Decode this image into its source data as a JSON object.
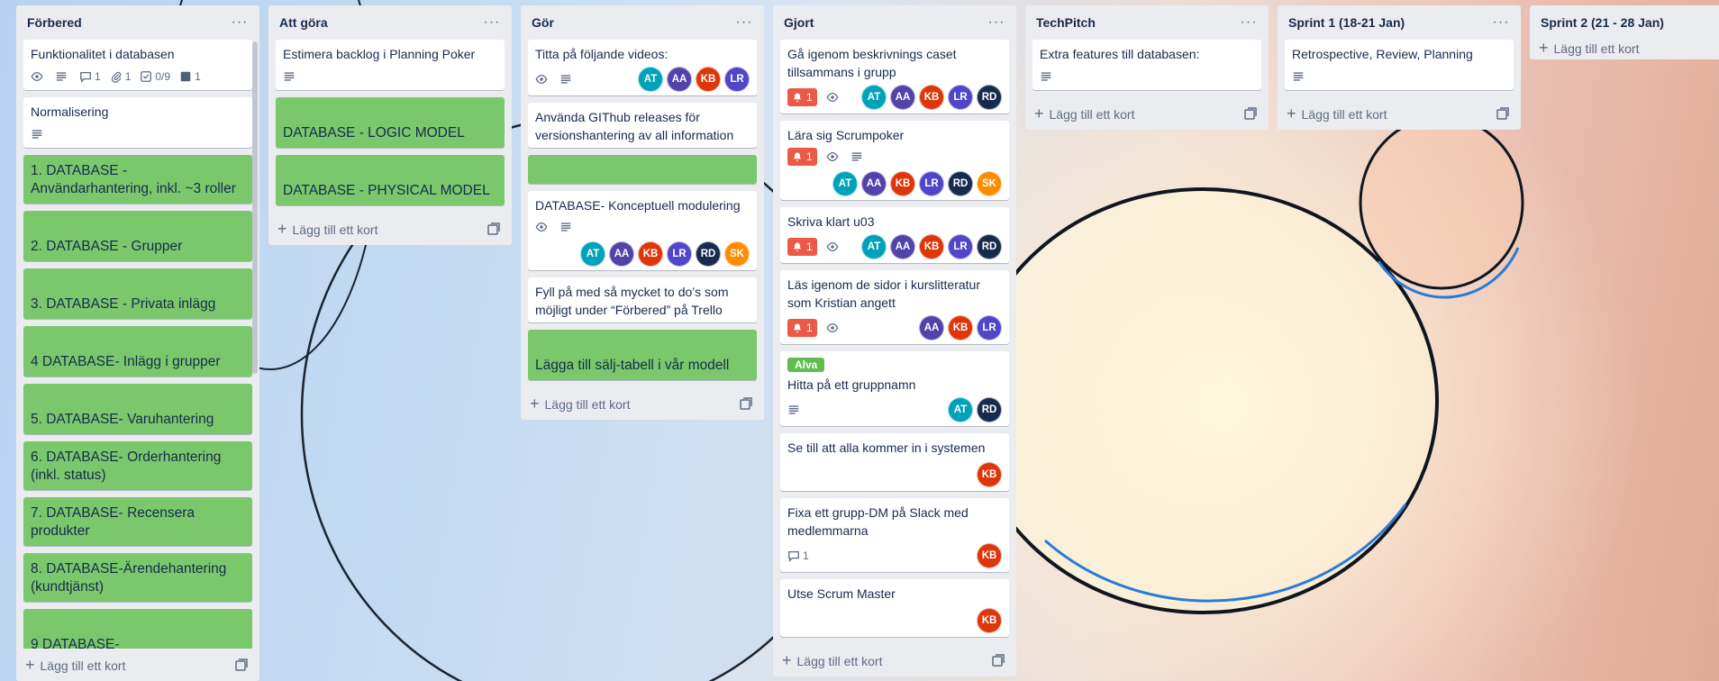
{
  "add_card_label": "Lägg till ett kort",
  "colors": {
    "green_card": "#7bc86c",
    "notification": "#eb5a46",
    "label_green": "#61bd4f"
  },
  "members": {
    "AT": {
      "initials": "AT",
      "color": "#00a2b9"
    },
    "AA": {
      "initials": "AA",
      "color": "#5243aa"
    },
    "KB": {
      "initials": "KB",
      "color": "#de350b"
    },
    "LR": {
      "initials": "LR",
      "color": "#4f46c8"
    },
    "RD": {
      "initials": "RD",
      "color": "#172b4d"
    },
    "SK": {
      "initials": "SK",
      "color": "#ff8b00"
    }
  },
  "lists": [
    {
      "title": "Förbered",
      "cards": [
        {
          "title": "Funktionalitet i databasen",
          "badges": {
            "watch": true,
            "desc": true,
            "comments": "1",
            "attachments": "1",
            "checklist": "0/9",
            "cover": "1"
          }
        },
        {
          "title": "Normalisering",
          "badges": {
            "desc": true
          }
        },
        {
          "title": "1. DATABASE - Användarhantering, inkl. ~3 roller",
          "green": true
        },
        {
          "title": "2. DATABASE - Grupper",
          "green": true
        },
        {
          "title": "3. DATABASE - Privata inlägg",
          "green": true
        },
        {
          "title": "4 DATABASE- Inlägg i grupper",
          "green": true
        },
        {
          "title": "5. DATABASE- Varuhantering",
          "green": true
        },
        {
          "title": "6. DATABASE- Orderhantering (inkl. status)",
          "green": true
        },
        {
          "title": "7. DATABASE- Recensera produkter",
          "green": true
        },
        {
          "title": "8. DATABASE-Ärendehantering (kundtjänst)",
          "green": true
        },
        {
          "title": "9 DATABASE-",
          "green": true
        }
      ]
    },
    {
      "title": "Att göra",
      "cards": [
        {
          "title": "Estimera backlog i Planning Poker",
          "badges": {
            "desc": true
          }
        },
        {
          "title": "DATABASE - LOGIC MODEL",
          "green": true
        },
        {
          "title": "DATABASE - PHYSICAL MODEL",
          "green": true
        }
      ]
    },
    {
      "title": "Gör",
      "cards": [
        {
          "title": "Titta på följande videos:",
          "badges": {
            "watch": true,
            "desc": true
          },
          "members": [
            "AT",
            "AA",
            "KB",
            "LR"
          ]
        },
        {
          "title": "Använda GIThub releases för versionshantering av all information"
        },
        {
          "title": "",
          "green": true
        },
        {
          "title": "DATABASE- Konceptuell modulering",
          "badges": {
            "watch": true,
            "desc": true
          },
          "members": [
            "AT",
            "AA",
            "KB",
            "LR",
            "RD",
            "SK"
          ],
          "members_row": true
        },
        {
          "title": "Fyll på med så mycket to do’s som möjligt under “Förbered” på Trello"
        },
        {
          "title": "Lägga till sälj-tabell i vår modell",
          "green": true
        }
      ]
    },
    {
      "title": "Gjort",
      "cards": [
        {
          "title": "Gå igenom beskrivnings caset tillsammans i grupp",
          "badges": {
            "notif": "1",
            "watch": true
          },
          "members": [
            "AT",
            "AA",
            "KB",
            "LR",
            "RD"
          ]
        },
        {
          "title": "Lära sig Scrumpoker",
          "badges": {
            "notif": "1",
            "watch": true,
            "desc": true
          },
          "members": [
            "AT",
            "AA",
            "KB",
            "LR",
            "RD",
            "SK"
          ],
          "members_row": true
        },
        {
          "title": "Skriva klart u03",
          "badges": {
            "notif": "1",
            "watch": true
          },
          "members": [
            "AT",
            "AA",
            "KB",
            "LR",
            "RD"
          ]
        },
        {
          "title": "Läs igenom de sidor i kurslitteratur som Kristian angett",
          "badges": {
            "notif": "1",
            "watch": true
          },
          "members": [
            "AA",
            "KB",
            "LR"
          ]
        },
        {
          "title": "Hitta på ett gruppnamn",
          "label": "Alva",
          "badges": {
            "desc": true
          },
          "members": [
            "AT",
            "RD"
          ]
        },
        {
          "title": "Se till att alla kommer in i systemen",
          "members": [
            "KB"
          ],
          "members_row": true
        },
        {
          "title": "Fixa ett grupp-DM på Slack med medlemmarna",
          "badges": {
            "comments": "1"
          },
          "members": [
            "KB"
          ]
        },
        {
          "title": "Utse Scrum Master",
          "members": [
            "KB"
          ],
          "members_row": true
        }
      ]
    },
    {
      "title": "TechPitch",
      "cards": [
        {
          "title": "Extra features till databasen:",
          "badges": {
            "desc": true
          }
        }
      ]
    },
    {
      "title": "Sprint 1 (18-21 Jan)",
      "cards": [
        {
          "title": "Retrospective, Review, Planning",
          "badges": {
            "desc": true
          }
        }
      ]
    },
    {
      "title": "Sprint 2 (21 - 28 Jan)",
      "cards": []
    }
  ]
}
